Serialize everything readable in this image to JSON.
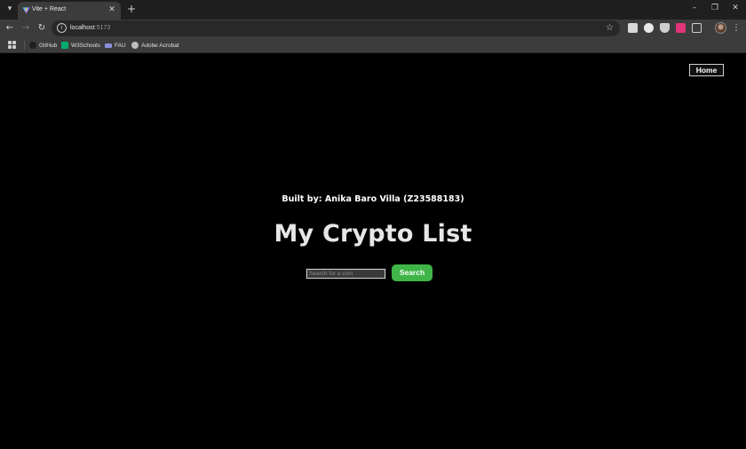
{
  "browser": {
    "tab": {
      "title": "Vite + React",
      "favicon": "vite-icon"
    },
    "address": {
      "host": "localhost",
      "port": ":5173"
    },
    "bookmarks": [
      {
        "label": "GitHub",
        "icon": "github-icon",
        "color": "#e0e0e0"
      },
      {
        "label": "W3Schools",
        "icon": "w3schools-icon",
        "color": "#04aa6d"
      },
      {
        "label": "FAU",
        "icon": "fau-icon",
        "color": "#8a8fd8"
      },
      {
        "label": "Adobe Acrobat",
        "icon": "acrobat-icon",
        "color": "#bdbdbd"
      }
    ],
    "icons": {
      "tab_menu": "▾",
      "close": "✕",
      "new_tab": "+",
      "minimize": "–",
      "restore": "❐",
      "back": "←",
      "forward": "→",
      "reload": "↻",
      "site_info": "i",
      "star": "☆",
      "kebab": "⋮"
    }
  },
  "page": {
    "nav": {
      "home_label": "Home"
    },
    "built_by": "Built by: Anika Baro Villa (Z23588183)",
    "title": "My Crypto List",
    "search": {
      "placeholder": "Search for a coin",
      "value": "",
      "button_label": "Search"
    }
  },
  "colors": {
    "background": "#000000",
    "accent": "#3fb548",
    "text": "#ffffff"
  }
}
